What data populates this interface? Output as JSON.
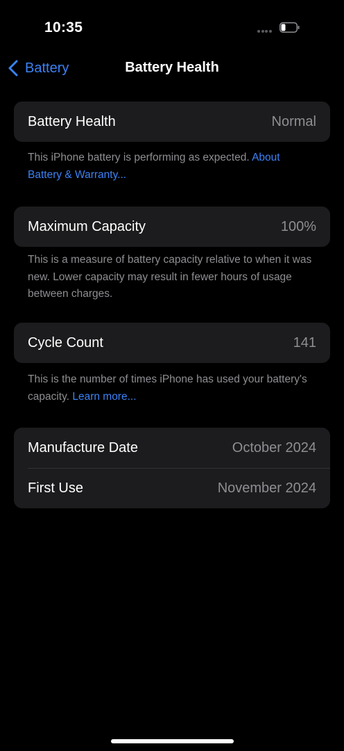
{
  "status_bar": {
    "time": "10:35",
    "battery_icon": "battery-low-icon",
    "signal_icon": "signal-dots-icon"
  },
  "nav": {
    "back_label": "Battery",
    "back_icon": "chevron-left-icon",
    "title": "Battery Health"
  },
  "sections": {
    "health": {
      "label": "Battery Health",
      "value": "Normal",
      "footer_text": "This iPhone battery is performing as expected. ",
      "footer_link": "About Battery & Warranty..."
    },
    "capacity": {
      "label": "Maximum Capacity",
      "value": "100%",
      "footer_text": "This is a measure of battery capacity relative to when it was new. Lower capacity may result in fewer hours of usage between charges."
    },
    "cycle": {
      "label": "Cycle Count",
      "value": "141",
      "footer_text": "This is the number of times iPhone has used your battery's capacity. ",
      "footer_link": "Learn more..."
    },
    "dates": {
      "manufacture_label": "Manufacture Date",
      "manufacture_value": "October 2024",
      "first_use_label": "First Use",
      "first_use_value": "November 2024"
    }
  },
  "colors": {
    "background": "#000000",
    "card": "#1c1c1e",
    "accent": "#3b82f6",
    "secondary_text": "#8e8e93"
  }
}
